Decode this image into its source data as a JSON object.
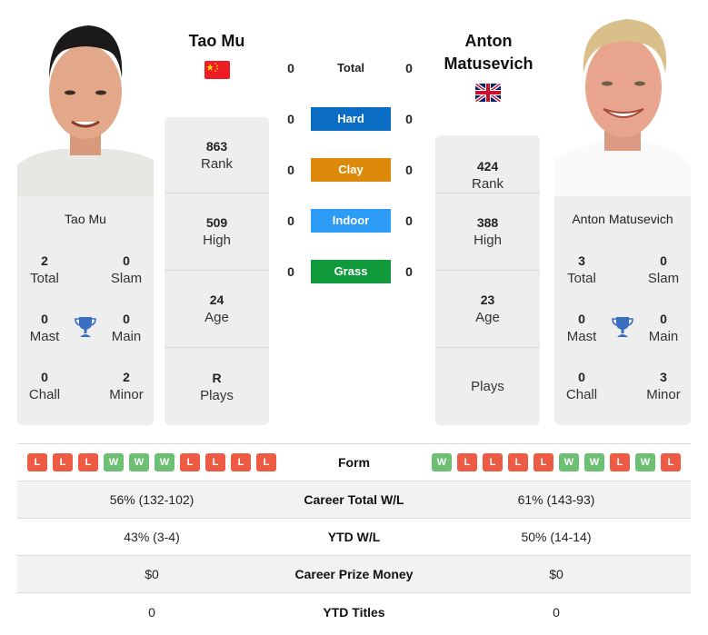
{
  "colors": {
    "hard": "#0a6cc2",
    "clay": "#dd8a0a",
    "indoor": "#2c9cf7",
    "grass": "#119a3c",
    "win": "#6cbf73",
    "loss": "#ee5b45",
    "trophy": "#3a6fbf"
  },
  "players": {
    "left": {
      "name": "Tao Mu",
      "flag_icon": "china-flag-icon",
      "card_name": "Tao Mu",
      "stats": [
        {
          "value": "863",
          "label": "Rank"
        },
        {
          "value": "509",
          "label": "High"
        },
        {
          "value": "24",
          "label": "Age"
        },
        {
          "value": "R",
          "label": "Plays"
        }
      ],
      "titles": {
        "total": {
          "value": "2",
          "label": "Total"
        },
        "slam": {
          "value": "0",
          "label": "Slam"
        },
        "mast": {
          "value": "0",
          "label": "Mast"
        },
        "main": {
          "value": "0",
          "label": "Main"
        },
        "chall": {
          "value": "0",
          "label": "Chall"
        },
        "minor": {
          "value": "2",
          "label": "Minor"
        }
      },
      "form": [
        "L",
        "L",
        "L",
        "W",
        "W",
        "W",
        "L",
        "L",
        "L",
        "L"
      ]
    },
    "right": {
      "name": "Anton Matusevich",
      "flag_icon": "uk-flag-icon",
      "card_name": "Anton Matusevich",
      "stats": [
        {
          "value": "424",
          "label": "Rank"
        },
        {
          "value": "388",
          "label": "High"
        },
        {
          "value": "23",
          "label": "Age"
        },
        {
          "value": "",
          "label": "Plays"
        }
      ],
      "titles": {
        "total": {
          "value": "3",
          "label": "Total"
        },
        "slam": {
          "value": "0",
          "label": "Slam"
        },
        "mast": {
          "value": "0",
          "label": "Mast"
        },
        "main": {
          "value": "0",
          "label": "Main"
        },
        "chall": {
          "value": "0",
          "label": "Chall"
        },
        "minor": {
          "value": "3",
          "label": "Minor"
        }
      },
      "form": [
        "W",
        "L",
        "L",
        "L",
        "L",
        "W",
        "W",
        "L",
        "W",
        "L"
      ]
    }
  },
  "h2h": {
    "total": {
      "label": "Total",
      "left": "0",
      "right": "0"
    },
    "surfaces": [
      {
        "label": "Hard",
        "left": "0",
        "right": "0"
      },
      {
        "label": "Clay",
        "left": "0",
        "right": "0"
      },
      {
        "label": "Indoor",
        "left": "0",
        "right": "0"
      },
      {
        "label": "Grass",
        "left": "0",
        "right": "0"
      }
    ]
  },
  "comparison": {
    "form_label": "Form",
    "rows": [
      {
        "label": "Career Total W/L",
        "left": "56% (132-102)",
        "right": "61% (143-93)"
      },
      {
        "label": "YTD W/L",
        "left": "43% (3-4)",
        "right": "50% (14-14)"
      },
      {
        "label": "Career Prize Money",
        "left": "$0",
        "right": "$0"
      },
      {
        "label": "YTD Titles",
        "left": "0",
        "right": "0"
      }
    ]
  }
}
